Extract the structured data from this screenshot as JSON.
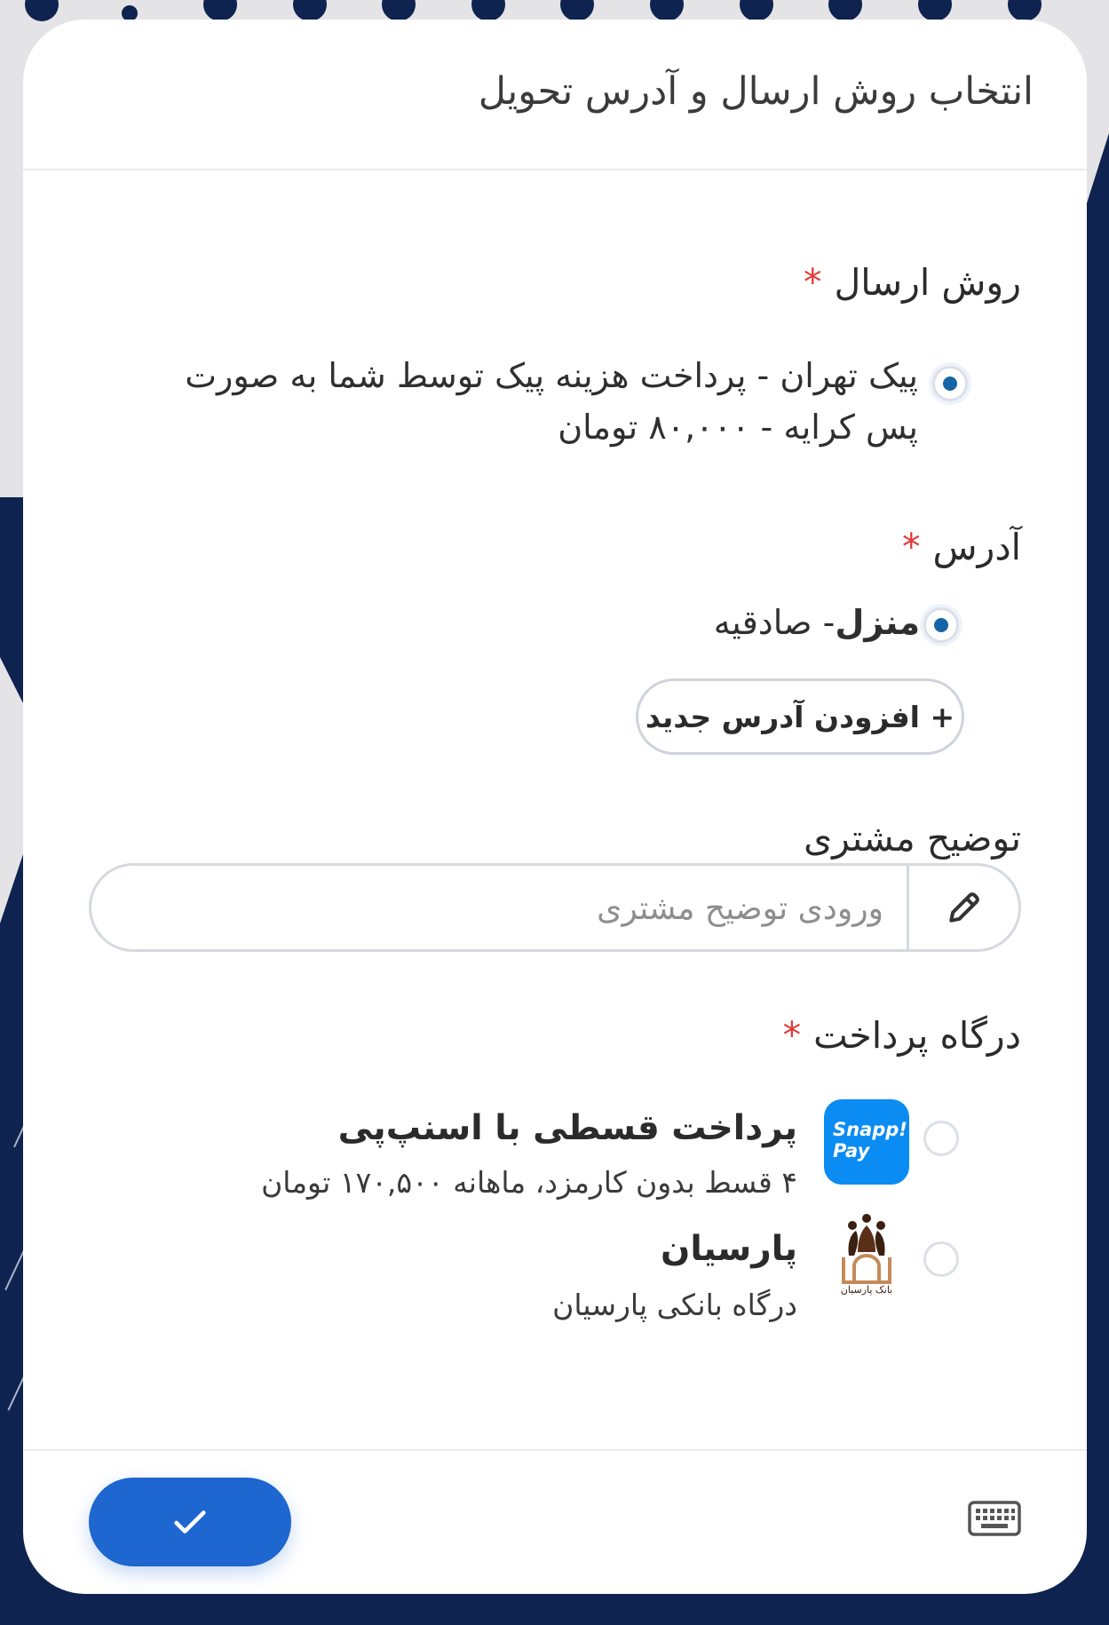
{
  "dialog": {
    "title": "انتخاب روش ارسال و آدرس تحویل"
  },
  "shipping": {
    "label": "روش ارسال",
    "required_mark": "*",
    "option_line1": "پیک تهران - پرداخت هزینه پیک توسط شما به صورت",
    "option_line2": "پس کرایه - ۸۰,۰۰۰ تومان",
    "selected": true
  },
  "address": {
    "label": "آدرس",
    "required_mark": "*",
    "option_bold": "منزل",
    "option_rest": "- صادقیه",
    "selected": true,
    "add_button": "+ افزودن آدرس جدید"
  },
  "note": {
    "label": "توضیح مشتری",
    "placeholder": "ورودی توضیح مشتری",
    "value": ""
  },
  "payment": {
    "label": "درگاه پرداخت",
    "required_mark": "*",
    "options": [
      {
        "title": "پرداخت قسطی با اسنپ‌پی",
        "subtitle": "۴ قسط بدون کارمزد، ماهانه ۱۷۰,۵۰۰ تومان",
        "logo_text_1": "Snapp!",
        "logo_text_2": "Pay",
        "logo_color": "#0b8cf2",
        "selected": false
      },
      {
        "title": "پارسیان",
        "subtitle": "درگاه بانکی پارسیان",
        "logo_caption": "بانک پارسیان",
        "logo_color": "#7a3e1d",
        "selected": false
      }
    ]
  },
  "footer": {
    "confirm_icon": "check-icon",
    "keyboard_icon": "keyboard-icon"
  },
  "colors": {
    "accent": "#1e66d0",
    "radio_selected": "#1565a6",
    "required": "#e53935",
    "background_dark": "#0f2350"
  }
}
